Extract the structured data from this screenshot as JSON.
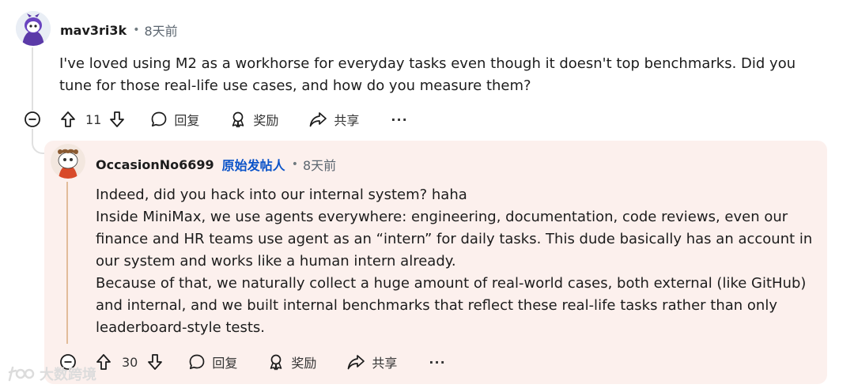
{
  "comment": {
    "username": "mav3ri3k",
    "separator": "•",
    "time": "8天前",
    "body_line1": "I've loved using M2 as a workhorse for everyday tasks even though it doesn't top benchmarks. Did you",
    "body_line2": "tune for those real-life use cases, and how do you measure them?",
    "votes": "11",
    "reply_label": "回复",
    "award_label": "奖励",
    "share_label": "共享",
    "more_label": "···"
  },
  "reply": {
    "username": "OccasionNo6699",
    "op_badge": "原始发帖人",
    "separator": "•",
    "time": "8天前",
    "lines": [
      "Indeed, did you hack into our internal system? haha",
      "Inside MiniMax, we use agents everywhere: engineering, documentation, code reviews, even our",
      "finance and HR teams use agent as an “intern” for daily tasks. This dude basically has an account in",
      "our system and works like a human intern already.",
      "Because of that, we naturally collect a huge amount of real-world cases, both external (like GitHub)",
      "and internal, and we built internal benchmarks that reflect these real-life tasks rather than only",
      "leaderboard-style tests."
    ],
    "votes": "30",
    "reply_label": "回复",
    "award_label": "奖励",
    "share_label": "共享",
    "more_label": "···"
  },
  "watermark": {
    "text": "大数跨境"
  },
  "icons": {
    "upvote": "arrow-up-icon",
    "downvote": "arrow-down-icon",
    "reply": "speech-bubble-icon",
    "award": "award-icon",
    "share": "share-arrow-icon",
    "collapse": "minus-circle-icon"
  },
  "colors": {
    "reply_background": "#fcf0ed",
    "op_badge": "#0a53c9",
    "reply_thread_line": "#e2bc9a"
  }
}
